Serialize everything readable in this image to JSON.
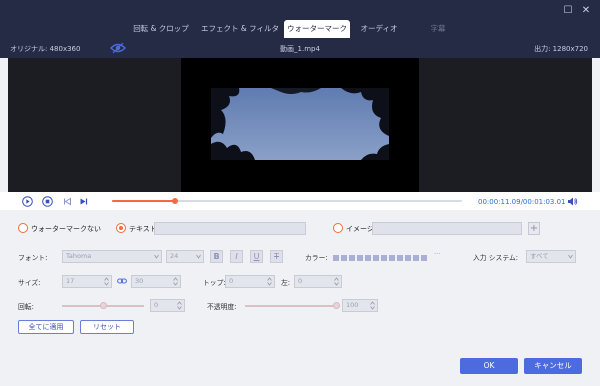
{
  "window": {
    "minimize_glyph": "☐",
    "close_glyph": "✕"
  },
  "tabs": [
    {
      "label": "回転 & クロップ",
      "state": "normal"
    },
    {
      "label": "エフェクト & フィルター",
      "state": "normal"
    },
    {
      "label": "ウォーターマーク",
      "state": "active"
    },
    {
      "label": "オーディオ",
      "state": "normal"
    },
    {
      "label": "字幕",
      "state": "disabled"
    }
  ],
  "infobar": {
    "original": "オリジナル: 480x360",
    "filename": "動画_1.mp4",
    "output": "出力: 1280x720",
    "eye_icon": "eye-icon"
  },
  "player": {
    "current_time": "00:00:11.09",
    "total_time": "/00:01:03.01",
    "progress_fraction": 0.18,
    "accent": "#f26a3d",
    "time_color": "#2f6bd6"
  },
  "watermark": {
    "none_label": "ウォーターマークない",
    "text_label": "テキスト",
    "text_value": "",
    "image_label": "イメージ",
    "image_value": "",
    "selected": "text",
    "plus_glyph": "+"
  },
  "font_row": {
    "font_label": "フォント:",
    "font_value": "Tahoma",
    "size_value": "24",
    "bold": "B",
    "italic": "I",
    "underline": "U",
    "strike": "T",
    "color_label": "カラー:",
    "color_more": "···",
    "input_system_label": "入力 システム:",
    "input_system_value": "すべて"
  },
  "size_row": {
    "size_label": "サイズ:",
    "width_value": "17",
    "height_value": "30",
    "top_label": "トップ:",
    "top_value": "0",
    "left_label": "左:",
    "left_value": "0"
  },
  "rotate_row": {
    "rotate_label": "回転:",
    "rotate_value": "0",
    "rotate_fraction": 0.5,
    "opacity_label": "不透明度:",
    "opacity_value": "100",
    "opacity_fraction": 1.0
  },
  "actions": {
    "apply_all": "全てに適用",
    "reset": "リセット",
    "ok": "OK",
    "cancel": "キャンセル"
  },
  "colors": {
    "titlebar": "#262b45",
    "primary": "#4d6bde",
    "accent": "#f26a3d"
  }
}
